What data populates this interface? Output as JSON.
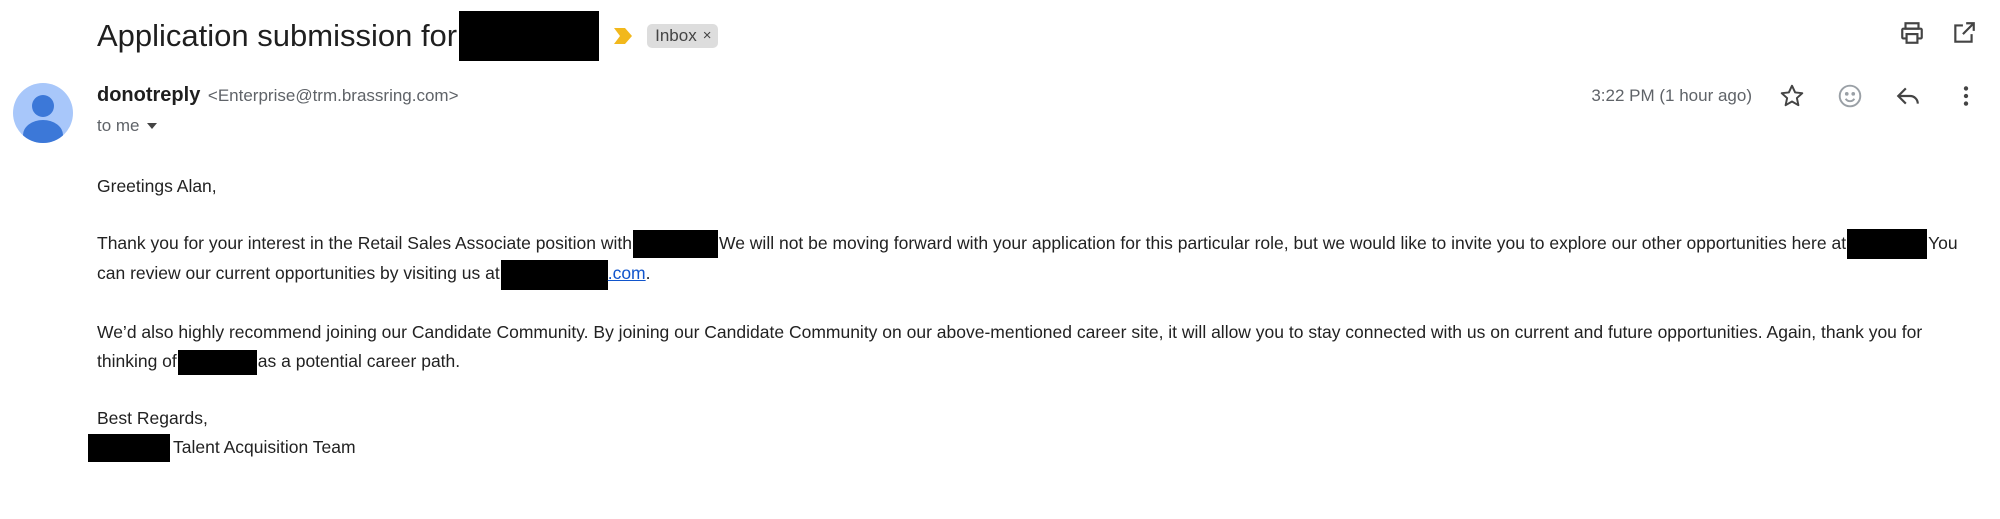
{
  "email": {
    "subject": "Application submission for",
    "label": "Inbox",
    "label_remove": "×",
    "sender_name": "donotreply",
    "sender_email": "<Enterprise@trm.brassring.com>",
    "recipient": "to me",
    "timestamp": "3:22 PM (1 hour ago)"
  },
  "body": {
    "greeting": "Greetings Alan,",
    "p1_a": "Thank you for your interest in the Retail Sales Associate position with",
    "p1_b": "We will not be moving forward with your application for this particular role, but we would like to invite you to explore our other opportunities here at",
    "p1_c": "You can review our current opportunities by visiting us at",
    "p1_link": ".com",
    "p1_end": ".",
    "p2_a": "We’d also highly recommend joining our Candidate Community. By joining our Candidate Community on our above-mentioned career site, it will allow you to stay connected with us on current and future opportunities. Again, thank you for thinking of",
    "p2_b": "as a potential career path.",
    "closing": "Best Regards,",
    "signature": "Talent Acquisition Team"
  },
  "colors": {
    "importance": "#f2b81c",
    "avatar_bg": "#a8c7fa",
    "avatar_fg": "#3c78d8",
    "link": "#1155cc"
  }
}
